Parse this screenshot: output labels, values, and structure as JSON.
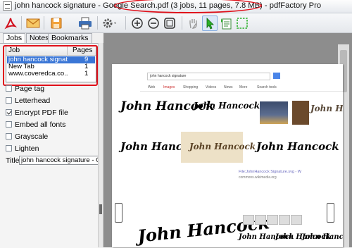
{
  "window": {
    "title": "john hancock signature - Google Search.pdf (3 jobs, 11 pages, 7.8 MB) - pdfFactory Pro"
  },
  "toolbar": {
    "icons": [
      "pdf-icon",
      "email-icon",
      "save-icon",
      "print-icon",
      "gear-icon",
      "zoom-in-icon",
      "zoom-out-icon",
      "fit-page-icon",
      "hand-icon",
      "arrow-icon",
      "text-select-icon",
      "marquee-icon"
    ]
  },
  "tabs": [
    "Jobs",
    "Notes",
    "Bookmarks"
  ],
  "jobs": {
    "columns": {
      "job": "Job",
      "pages": "Pages"
    },
    "rows": [
      {
        "name": "john hancock signat...",
        "pages": "9",
        "selected": true
      },
      {
        "name": "New Tab",
        "pages": "1",
        "selected": false
      },
      {
        "name": "www.coveredca.co...",
        "pages": "1",
        "selected": false
      }
    ]
  },
  "options": [
    {
      "label": "Page tag",
      "checked": false
    },
    {
      "label": "Letterhead",
      "checked": false
    },
    {
      "label": "Encrypt PDF file",
      "checked": true
    },
    {
      "label": "Embed all fonts",
      "checked": false
    },
    {
      "label": "Grayscale",
      "checked": false
    },
    {
      "label": "Lighten",
      "checked": false
    }
  ],
  "title_field": {
    "label": "Title:",
    "value": "john hancock signature - Goo"
  },
  "preview": {
    "search_query": "john hancock signature",
    "menu": [
      "Web",
      "Images",
      "Shopping",
      "Videos",
      "News",
      "More",
      "Search tools"
    ],
    "signature_text": "John Hancock",
    "result_title": "File:JohnHancock Signature.svg - W",
    "result_sub": "commons.wikimedia.org"
  },
  "colors": {
    "accent_red": "#e0101a",
    "selection_blue": "#3a76d6"
  }
}
